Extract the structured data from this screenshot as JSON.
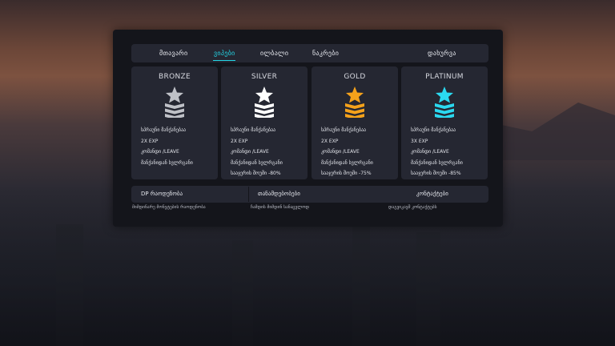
{
  "nav": {
    "tabs": [
      {
        "label": "მთავარი",
        "active": false
      },
      {
        "label": "ვიპები",
        "active": true
      },
      {
        "label": "ილბალი",
        "active": false
      },
      {
        "label": "ნაკრები",
        "active": false
      }
    ],
    "close_label": "დახურვა"
  },
  "accent_color": "#24d6e6",
  "tiers": [
    {
      "name": "BRONZE",
      "icon": "rank-chevron-star-icon",
      "color": "#bfc1c7",
      "perks": [
        "სპრაუნი მანქანებაა",
        "2X EXP",
        "კომანდი /LEAVE",
        "მანქანიდან სვლრგანი"
      ]
    },
    {
      "name": "SILVER",
      "icon": "rank-chevron-star-icon",
      "color": "#ffffff",
      "perks": [
        "სპრაუნი მანქანებაა",
        "2X EXP",
        "კომანდი /LEAVE",
        "მანქანიდან სვლრგანი",
        "სააჯერის შოუმი -80%"
      ]
    },
    {
      "name": "GOLD",
      "icon": "rank-chevron-star-icon",
      "color": "#f5a21b",
      "perks": [
        "სპრაუნი მანქანებაა",
        "2X EXP",
        "კომანდი /LEAVE",
        "მანქანიდან სვლრგანი",
        "სააჯერის შოუმი -75%"
      ]
    },
    {
      "name": "PLATINUM",
      "icon": "rank-chevron-star-icon",
      "color": "#2bd9f0",
      "perks": [
        "სპრაუნი მანქანებაა",
        "3X EXP",
        "კომანდი /LEAVE",
        "მანქანიდან სვლრგანი",
        "სააჯერის შოუმი -85%"
      ]
    }
  ],
  "info": {
    "dp_label": "DP რაოდენობა",
    "dp_sub": "მიმდინარე მონეტების რაოდენობა",
    "status_label": "თანამდებობები",
    "status_sub": "ჩამდის მიმდინ სანაცვლოდ",
    "contact_label": "კონტაქტები",
    "contact_sub": "დაგვიკავშ კონტაქტებს"
  }
}
